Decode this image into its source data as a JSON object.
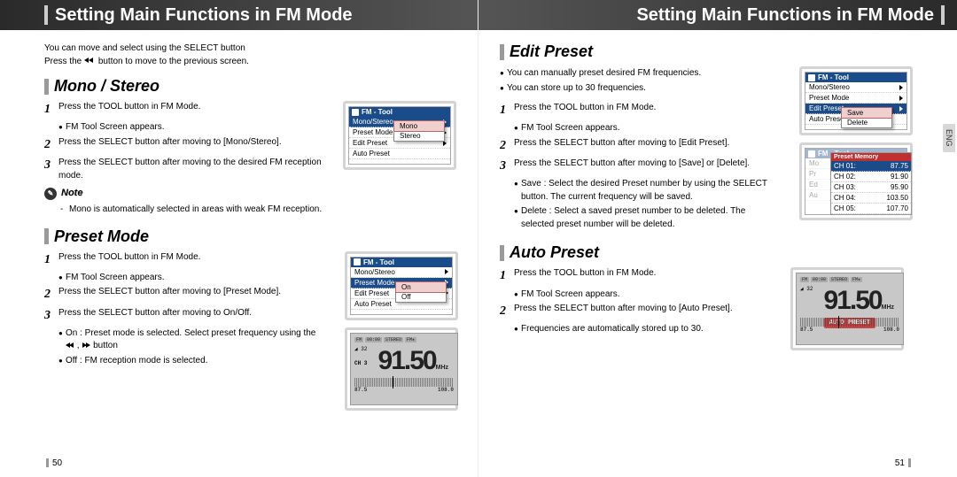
{
  "titlebar": {
    "left": "Setting Main Functions in FM Mode",
    "right": "Setting Main Functions in FM Mode"
  },
  "intro": {
    "line1": "You can move and select using the SELECT button",
    "line2a": "Press the",
    "line2b": "button to move to the previous screen."
  },
  "eng_tab": "ENG",
  "page_left": "50",
  "page_right": "51",
  "mono_stereo": {
    "heading": "Mono / Stereo",
    "step1": "Press the TOOL button in FM Mode.",
    "step1_bullet": "FM Tool Screen appears.",
    "step2": "Press the SELECT button after moving to [Mono/Stereo].",
    "step3": "Press the SELECT button after moving to the desired FM reception mode.",
    "note_label": "Note",
    "note_text": "Mono is automatically selected in areas with weak FM reception.",
    "screen": {
      "title": "FM - Tool",
      "items": [
        "Mono/Stereo",
        "Preset Mode",
        "Edit Preset",
        "Auto Preset"
      ],
      "submenu": [
        "Mono",
        "Stereo"
      ]
    }
  },
  "preset_mode": {
    "heading": "Preset Mode",
    "step1": "Press the TOOL button in FM Mode.",
    "step1_bullet": "FM Tool Screen appears.",
    "step2": "Press the SELECT button after moving to [Preset Mode].",
    "step3": "Press the SELECT button after moving to On/Off.",
    "bullet_on": "On : Preset mode is selected. Select preset frequency using the",
    "bullet_on_end": "button",
    "bullet_off": "Off : FM reception mode is selected.",
    "screen": {
      "title": "FM - Tool",
      "items": [
        "Mono/Stereo",
        "Preset Mode",
        "Edit Preset",
        "Auto Preset"
      ],
      "submenu": [
        "On",
        "Off"
      ]
    },
    "radio": {
      "freq": "91.50",
      "mhz": "MHz",
      "ch": "CH 3",
      "bars": "32",
      "left": "87.5",
      "right": "108.0"
    }
  },
  "edit_preset": {
    "heading": "Edit Preset",
    "intro1": "You can manually preset desired FM frequencies.",
    "intro2": "You can store up to 30 frequencies.",
    "step1": "Press the TOOL button in FM Mode.",
    "step1_bullet": "FM Tool Screen appears.",
    "step2": "Press the SELECT button after moving to [Edit Preset].",
    "step3": "Press the SELECT button after moving to [Save] or [Delete].",
    "bullet_save": "Save : Select the desired Preset number by using the SELECT button. The current frequency will be saved.",
    "bullet_delete": "Delete : Select a saved preset number to be deleted. The selected preset number will be deleted.",
    "screen": {
      "title": "FM - Tool",
      "items": [
        "Mono/Stereo",
        "Preset Mode",
        "Edit Preset",
        "Auto Preset"
      ],
      "submenu": [
        "Save",
        "Delete"
      ]
    },
    "preset_mem": {
      "title": "Preset Memory",
      "rows": [
        {
          "ch": "CH 01:",
          "f": "87.75"
        },
        {
          "ch": "CH 02:",
          "f": "91.90"
        },
        {
          "ch": "CH 03:",
          "f": "95.90"
        },
        {
          "ch": "CH 04:",
          "f": "103.50"
        },
        {
          "ch": "CH 05:",
          "f": "107.70"
        }
      ]
    }
  },
  "auto_preset": {
    "heading": "Auto Preset",
    "step1": "Press the TOOL button in FM Mode.",
    "step1_bullet": "FM Tool Screen appears.",
    "step2": "Press the SELECT button after moving to [Auto Preset].",
    "bullet": "Frequencies are automatically stored up to 30.",
    "radio": {
      "freq": "91.50",
      "mhz": "MHz",
      "bars": "32",
      "left": "87.5",
      "right": "108.0",
      "badge": "AUTO PRESET"
    }
  }
}
